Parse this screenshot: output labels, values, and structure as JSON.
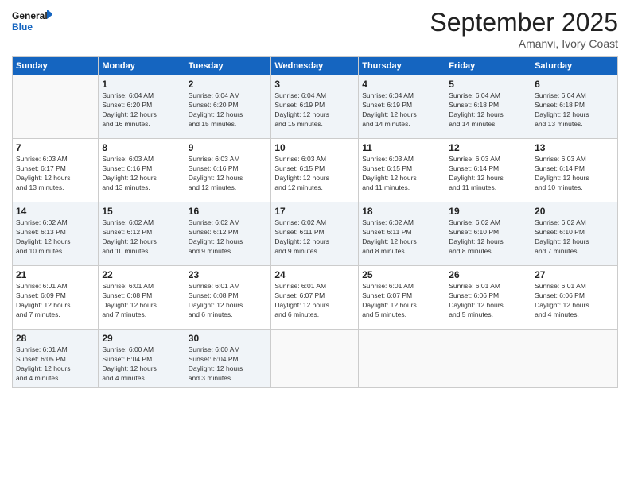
{
  "logo": {
    "line1": "General",
    "line2": "Blue"
  },
  "title": "September 2025",
  "location": "Amanvi, Ivory Coast",
  "days_header": [
    "Sunday",
    "Monday",
    "Tuesday",
    "Wednesday",
    "Thursday",
    "Friday",
    "Saturday"
  ],
  "weeks": [
    [
      {
        "day": "",
        "info": ""
      },
      {
        "day": "1",
        "info": "Sunrise: 6:04 AM\nSunset: 6:20 PM\nDaylight: 12 hours\nand 16 minutes."
      },
      {
        "day": "2",
        "info": "Sunrise: 6:04 AM\nSunset: 6:20 PM\nDaylight: 12 hours\nand 15 minutes."
      },
      {
        "day": "3",
        "info": "Sunrise: 6:04 AM\nSunset: 6:19 PM\nDaylight: 12 hours\nand 15 minutes."
      },
      {
        "day": "4",
        "info": "Sunrise: 6:04 AM\nSunset: 6:19 PM\nDaylight: 12 hours\nand 14 minutes."
      },
      {
        "day": "5",
        "info": "Sunrise: 6:04 AM\nSunset: 6:18 PM\nDaylight: 12 hours\nand 14 minutes."
      },
      {
        "day": "6",
        "info": "Sunrise: 6:04 AM\nSunset: 6:18 PM\nDaylight: 12 hours\nand 13 minutes."
      }
    ],
    [
      {
        "day": "7",
        "info": "Sunrise: 6:03 AM\nSunset: 6:17 PM\nDaylight: 12 hours\nand 13 minutes."
      },
      {
        "day": "8",
        "info": "Sunrise: 6:03 AM\nSunset: 6:16 PM\nDaylight: 12 hours\nand 13 minutes."
      },
      {
        "day": "9",
        "info": "Sunrise: 6:03 AM\nSunset: 6:16 PM\nDaylight: 12 hours\nand 12 minutes."
      },
      {
        "day": "10",
        "info": "Sunrise: 6:03 AM\nSunset: 6:15 PM\nDaylight: 12 hours\nand 12 minutes."
      },
      {
        "day": "11",
        "info": "Sunrise: 6:03 AM\nSunset: 6:15 PM\nDaylight: 12 hours\nand 11 minutes."
      },
      {
        "day": "12",
        "info": "Sunrise: 6:03 AM\nSunset: 6:14 PM\nDaylight: 12 hours\nand 11 minutes."
      },
      {
        "day": "13",
        "info": "Sunrise: 6:03 AM\nSunset: 6:14 PM\nDaylight: 12 hours\nand 10 minutes."
      }
    ],
    [
      {
        "day": "14",
        "info": "Sunrise: 6:02 AM\nSunset: 6:13 PM\nDaylight: 12 hours\nand 10 minutes."
      },
      {
        "day": "15",
        "info": "Sunrise: 6:02 AM\nSunset: 6:12 PM\nDaylight: 12 hours\nand 10 minutes."
      },
      {
        "day": "16",
        "info": "Sunrise: 6:02 AM\nSunset: 6:12 PM\nDaylight: 12 hours\nand 9 minutes."
      },
      {
        "day": "17",
        "info": "Sunrise: 6:02 AM\nSunset: 6:11 PM\nDaylight: 12 hours\nand 9 minutes."
      },
      {
        "day": "18",
        "info": "Sunrise: 6:02 AM\nSunset: 6:11 PM\nDaylight: 12 hours\nand 8 minutes."
      },
      {
        "day": "19",
        "info": "Sunrise: 6:02 AM\nSunset: 6:10 PM\nDaylight: 12 hours\nand 8 minutes."
      },
      {
        "day": "20",
        "info": "Sunrise: 6:02 AM\nSunset: 6:10 PM\nDaylight: 12 hours\nand 7 minutes."
      }
    ],
    [
      {
        "day": "21",
        "info": "Sunrise: 6:01 AM\nSunset: 6:09 PM\nDaylight: 12 hours\nand 7 minutes."
      },
      {
        "day": "22",
        "info": "Sunrise: 6:01 AM\nSunset: 6:08 PM\nDaylight: 12 hours\nand 7 minutes."
      },
      {
        "day": "23",
        "info": "Sunrise: 6:01 AM\nSunset: 6:08 PM\nDaylight: 12 hours\nand 6 minutes."
      },
      {
        "day": "24",
        "info": "Sunrise: 6:01 AM\nSunset: 6:07 PM\nDaylight: 12 hours\nand 6 minutes."
      },
      {
        "day": "25",
        "info": "Sunrise: 6:01 AM\nSunset: 6:07 PM\nDaylight: 12 hours\nand 5 minutes."
      },
      {
        "day": "26",
        "info": "Sunrise: 6:01 AM\nSunset: 6:06 PM\nDaylight: 12 hours\nand 5 minutes."
      },
      {
        "day": "27",
        "info": "Sunrise: 6:01 AM\nSunset: 6:06 PM\nDaylight: 12 hours\nand 4 minutes."
      }
    ],
    [
      {
        "day": "28",
        "info": "Sunrise: 6:01 AM\nSunset: 6:05 PM\nDaylight: 12 hours\nand 4 minutes."
      },
      {
        "day": "29",
        "info": "Sunrise: 6:00 AM\nSunset: 6:04 PM\nDaylight: 12 hours\nand 4 minutes."
      },
      {
        "day": "30",
        "info": "Sunrise: 6:00 AM\nSunset: 6:04 PM\nDaylight: 12 hours\nand 3 minutes."
      },
      {
        "day": "",
        "info": ""
      },
      {
        "day": "",
        "info": ""
      },
      {
        "day": "",
        "info": ""
      },
      {
        "day": "",
        "info": ""
      }
    ]
  ]
}
